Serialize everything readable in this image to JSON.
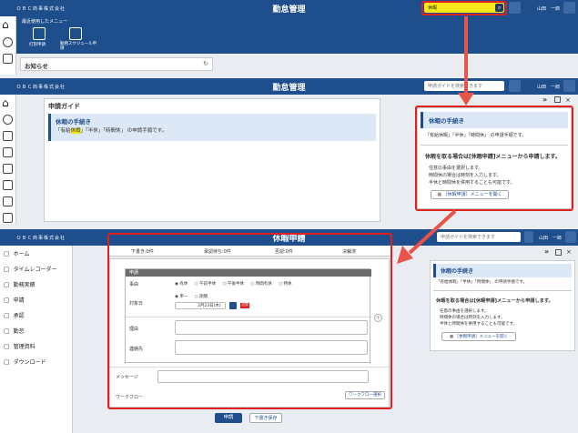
{
  "company": "ＯＢＣ商事株式会社",
  "app_title": "勤怠管理",
  "app_title_3": "休暇申請",
  "user_name": "山田　一郎",
  "screen1": {
    "search_value": "休暇",
    "recent_menu_label": "最近使用したメニュー",
    "shortcuts": [
      {
        "label": "打刻申請"
      },
      {
        "label": "勤務スケジュール申請"
      }
    ],
    "notice_label": "お知らせ"
  },
  "screen2": {
    "search_placeholder": "申請ガイドを検索できます",
    "page_title": "申請ガイド",
    "section_title": "休暇の手続き",
    "section_text_pre": "「有給",
    "section_text_hl": "休暇",
    "section_text_post": "」「半休」「時間休」 の申請手順です。",
    "side_title": "休暇の手続き",
    "side_text": "「有給休暇」「半休」「時間休」 の申請手順です。",
    "side_heading": "休暇を取る場合は[休暇申請]メニューから申請します。",
    "side_lines": [
      "任意の事由を選択します。",
      "時間休の場合は時刻を入力します。",
      "半休と時間休を併用することも可能です。"
    ],
    "side_button": "［休暇申請］メニューを開く"
  },
  "screen3": {
    "search_placeholder": "申請ガイドを検索できます",
    "tabs": [
      "下書き:0件",
      "承認待ち:0件",
      "否認:0件",
      "決裁済"
    ],
    "menu": [
      "ホーム",
      "タイムレコーダー",
      "勤務実績",
      "申請",
      "承認",
      "勤怠",
      "管理資料",
      "ダウンロード"
    ],
    "form_title": "申請",
    "reason_label": "事由",
    "reason_options": [
      "有休",
      "午前半休",
      "午後半休",
      "時間有休",
      "特休"
    ],
    "date_label": "対象日",
    "date_options": [
      "単一",
      "期間"
    ],
    "date_value": "3月23日(木)",
    "holiday_badge": "必須",
    "reason_text_label": "理由",
    "contact_label": "連絡先",
    "message_label": "メッセージ",
    "workflow_label": "ワークフロー",
    "workflow_button": "ワークフロー選択",
    "submit_button": "申請",
    "draft_button": "下書き保存",
    "side_title": "休暇の手続き",
    "side_text": "「有給休暇」「半休」「時間休」 の申請手順です。",
    "side_heading": "休暇を取る場合は[休暇申請]メニューから申請します。",
    "side_lines": [
      "任意の事由を選択します。",
      "時間休の場合は時刻を入力します。",
      "半休と時間休を併用することも可能です。"
    ],
    "side_button": "［休暇申請］メニューを開く"
  },
  "colors": {
    "header": "#1f4e8c",
    "highlight_red": "#e02020",
    "search_yellow": "#f5e71a"
  }
}
